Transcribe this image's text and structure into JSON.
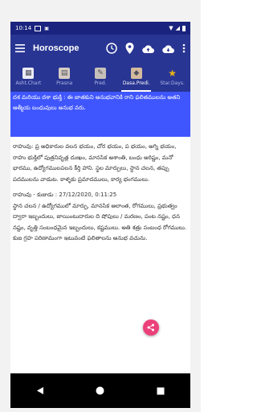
{
  "status": {
    "time": "10:14"
  },
  "appbar": {
    "title": "Horoscope"
  },
  "tabs": [
    {
      "label": "Asht.Chart",
      "icon": "chart-icon"
    },
    {
      "label": "Prasna",
      "icon": "prasna-icon"
    },
    {
      "label": "Pred.",
      "icon": "pred-icon"
    },
    {
      "label": "Dasa.Predi.",
      "icon": "dasa-icon"
    },
    {
      "label": "Star.Days.",
      "icon": "star-icon"
    }
  ],
  "content": {
    "highlight_text": "దశ మరియు దశా భుక్తి : ఈ జాతకుని అనుభవానికి రాని ఫలితములను అతని ఆత్మీయ బంధువులు అనుభ వరు.",
    "para1": "రాహువు: ప్ర అధికారుల వలన భయం, చోర భయం, ప భయం, అగ్ని భయం, రాహు భుక్తిలో పుత్రనివృత్ల దుఃఖం, మానసిక అశాంతి, బంధు అరిష్టం, మనో భారము, ఉద్యోగములపలన కీర్తి హాని. స్థల మార్పులు, స్థాన చలన, తప్పు పదములను వాడుట. కాళ్ళకు ప్రమాదములు, కార్య భంగములు.",
    "para2_heading": "రాహువు - కుజుడు : 27/12/2020, 0:11:25",
    "para2": "స్థాన చలన / ఉద్యోగములో మార్పు, మానసిక ఆలాంత, రోగములు, ప్రభుత్వం ద్వారా ఇబ్బందులు, జాయింటుదారుల ది షోపులు / మరణం, పంట నష్టం, ధన నష్టం, వృత్తి సంబంధమైన ఇబ్బందులు, కష్టములు. అతి శత్రు సంబంధ రోగములు. కుజ గ్రహ పరిణామంగా ఇటువంటి ఫలితాలను అనుభ వచును."
  },
  "colors": {
    "appbar": "#283593",
    "status": "#1a237e",
    "highlight": "#3f56ff",
    "fab": "#ec407a"
  }
}
